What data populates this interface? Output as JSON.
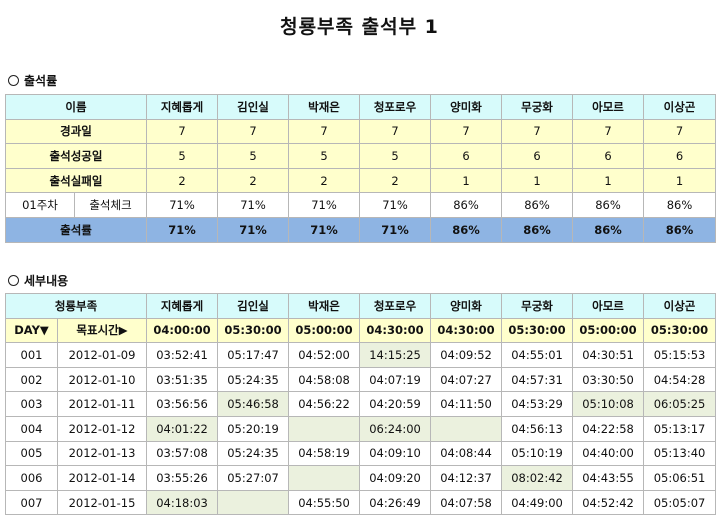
{
  "title": "청룡부족 출석부 1",
  "members": [
    "지혜롭게",
    "김인실",
    "박재은",
    "청포로우",
    "양미화",
    "무궁화",
    "아모르",
    "이상곤"
  ],
  "summary": {
    "heading": "출석률",
    "name_header": "이름",
    "rows": [
      {
        "label": "경과일",
        "values": [
          "7",
          "7",
          "7",
          "7",
          "7",
          "7",
          "7",
          "7"
        ]
      },
      {
        "label": "출석성공일",
        "values": [
          "5",
          "5",
          "5",
          "5",
          "6",
          "6",
          "6",
          "6"
        ]
      },
      {
        "label": "출석실패일",
        "values": [
          "2",
          "2",
          "2",
          "2",
          "1",
          "1",
          "1",
          "1"
        ]
      }
    ],
    "week": {
      "label": "01주차",
      "sub": "출석체크",
      "values": [
        "71%",
        "71%",
        "71%",
        "71%",
        "86%",
        "86%",
        "86%",
        "86%"
      ]
    },
    "rate": {
      "label": "출석률",
      "values": [
        "71%",
        "71%",
        "71%",
        "71%",
        "86%",
        "86%",
        "86%",
        "86%"
      ]
    }
  },
  "detail": {
    "heading": "세부내용",
    "tribe": "청룡부족",
    "day_label": "DAY▼",
    "goal_label": "목표시간▶",
    "goals": [
      "04:00:00",
      "05:30:00",
      "05:00:00",
      "04:30:00",
      "04:30:00",
      "05:30:00",
      "05:00:00",
      "05:30:00"
    ],
    "rows": [
      {
        "day": "001",
        "date": "2012-01-09",
        "times": [
          "03:52:41",
          "05:17:47",
          "04:52:00",
          "14:15:25",
          "04:09:52",
          "04:55:01",
          "04:30:51",
          "05:15:53"
        ],
        "late": [
          false,
          false,
          false,
          true,
          false,
          false,
          false,
          false
        ]
      },
      {
        "day": "002",
        "date": "2012-01-10",
        "times": [
          "03:51:35",
          "05:24:35",
          "04:58:08",
          "04:07:19",
          "04:07:27",
          "04:57:31",
          "03:30:50",
          "04:54:28"
        ],
        "late": [
          false,
          false,
          false,
          false,
          false,
          false,
          false,
          false
        ]
      },
      {
        "day": "003",
        "date": "2012-01-11",
        "times": [
          "03:56:56",
          "05:46:58",
          "04:56:22",
          "04:20:59",
          "04:11:50",
          "04:53:29",
          "05:10:08",
          "06:05:25"
        ],
        "late": [
          false,
          true,
          false,
          false,
          false,
          false,
          true,
          true
        ]
      },
      {
        "day": "004",
        "date": "2012-01-12",
        "times": [
          "04:01:22",
          "05:20:19",
          "",
          "06:24:00",
          "",
          "04:56:13",
          "04:22:58",
          "05:13:17"
        ],
        "late": [
          true,
          false,
          true,
          true,
          true,
          false,
          false,
          false
        ]
      },
      {
        "day": "005",
        "date": "2012-01-13",
        "times": [
          "03:57:08",
          "05:24:35",
          "04:58:19",
          "04:09:10",
          "04:08:44",
          "05:10:19",
          "04:40:00",
          "05:13:40"
        ],
        "late": [
          false,
          false,
          false,
          false,
          false,
          false,
          false,
          false
        ]
      },
      {
        "day": "006",
        "date": "2012-01-14",
        "times": [
          "03:55:26",
          "05:27:07",
          "",
          "04:09:20",
          "04:12:37",
          "08:02:42",
          "04:43:55",
          "05:06:51"
        ],
        "late": [
          false,
          false,
          true,
          false,
          false,
          true,
          false,
          false
        ]
      },
      {
        "day": "007",
        "date": "2012-01-15",
        "times": [
          "04:18:03",
          "",
          "04:55:50",
          "04:26:49",
          "04:07:58",
          "04:49:00",
          "04:52:42",
          "05:05:07"
        ],
        "late": [
          true,
          true,
          false,
          false,
          false,
          false,
          false,
          false
        ]
      }
    ]
  }
}
